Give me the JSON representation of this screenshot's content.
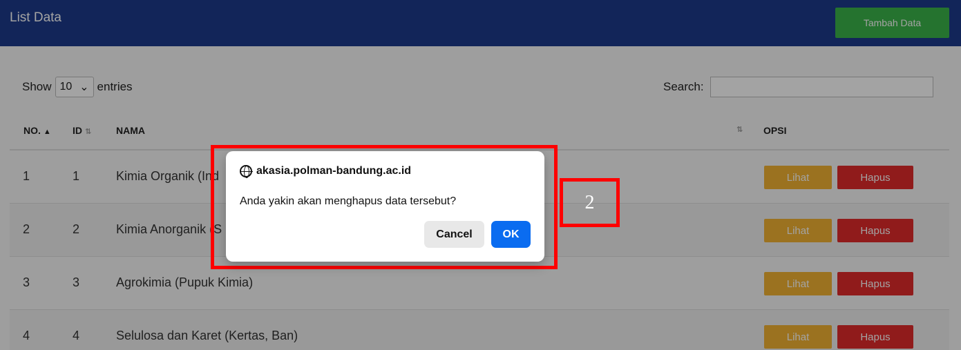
{
  "header": {
    "title": "List Data",
    "add_label": "Tambah Data"
  },
  "controls": {
    "show_label": "Show",
    "page_size": "10",
    "entries_label": "entries",
    "search_label": "Search:"
  },
  "table": {
    "columns": {
      "no": "NO.",
      "id": "ID",
      "nama": "NAMA",
      "opsi": "OPSI"
    },
    "rows": [
      {
        "no": "1",
        "id": "1",
        "nama": "Kimia Organik (Ind",
        "lihat": "Lihat",
        "hapus": "Hapus"
      },
      {
        "no": "2",
        "id": "2",
        "nama": "Kimia Anorganik (S",
        "lihat": "Lihat",
        "hapus": "Hapus"
      },
      {
        "no": "3",
        "id": "3",
        "nama": "Agrokimia (Pupuk Kimia)",
        "lihat": "Lihat",
        "hapus": "Hapus"
      },
      {
        "no": "4",
        "id": "4",
        "nama": "Selulosa dan Karet (Kertas, Ban)",
        "lihat": "Lihat",
        "hapus": "Hapus"
      }
    ]
  },
  "dialog": {
    "host": "akasia.polman-bandung.ac.id",
    "message": "Anda yakin akan menghapus data tersebut?",
    "cancel_label": "Cancel",
    "ok_label": "OK"
  },
  "annotation": {
    "label": "2"
  },
  "colors": {
    "header": "#1d3b8b",
    "add_button": "#3bb44a",
    "lihat": "#f2b233",
    "hapus": "#e12b2b",
    "ok": "#0a6cf0",
    "highlight": "#ff0000"
  }
}
